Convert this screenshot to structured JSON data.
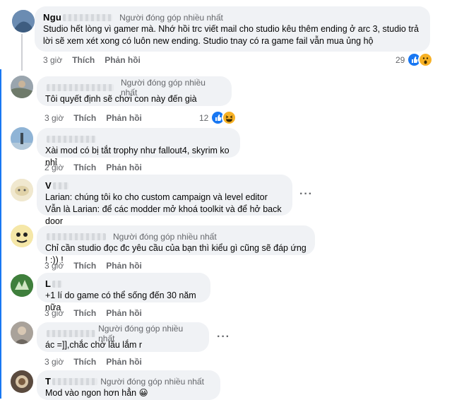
{
  "colors": {
    "bubble": "#f0f2f5",
    "meta": "#65676b",
    "like": "#1877f2",
    "emoji": "#f7b125"
  },
  "badge_label": "Người đóng góp nhiều nhất",
  "comments": [
    {
      "author": "Ngu",
      "badge": "Người đóng góp nhiều nhất",
      "text": "Studio hết lòng vì gamer mà. Nhớ hồi trc viết mail cho studio kêu thêm ending ở arc 3, studio trả lời sẽ xem xét xong có luôn new ending. Studio tnay có ra game fail vẫn mua ủng hộ",
      "time": "3 giờ",
      "like": "Thích",
      "reply": "Phản hồi",
      "reaction_count": "29",
      "reactions": [
        "like-icon",
        "wow-icon"
      ]
    },
    {
      "author": "",
      "badge": "Người đóng góp nhiều nhất",
      "text": "Tôi quyết định sẽ chơi con này đến già",
      "time": "3 giờ",
      "like": "Thích",
      "reply": "Phản hồi",
      "reaction_count": "12",
      "reactions": [
        "like-icon",
        "haha-icon"
      ]
    },
    {
      "author": "",
      "text": "Xài mod có bị tắt trophy như fallout4, skyrim ko nhỉ",
      "time": "2 giờ",
      "like": "Thích",
      "reply": "Phản hồi"
    },
    {
      "author": "V",
      "text": "Larian: chúng tôi ko cho custom campaign và level editor\nVẫn là Larian: để các modder mở khoá toolkit và để hở back door",
      "time": "",
      "like": "",
      "reply": ""
    },
    {
      "author": "",
      "badge": "Người đóng góp nhiều nhất",
      "text": "Chỉ cần studio đọc đc yêu cầu của bạn thì kiểu gì cũng sẽ đáp ứng ! :)) !",
      "time": "3 giờ",
      "like": "Thích",
      "reply": "Phản hồi"
    },
    {
      "author": "L",
      "text": "+1 lí do game có thể sống đến 30 năm nữa",
      "time": "3 giờ",
      "like": "Thích",
      "reply": "Phản hồi"
    },
    {
      "author": "",
      "badge": "Người đóng góp nhiều nhất",
      "text": "ác =]],chắc chờ lâu lắm r",
      "time": "3 giờ",
      "like": "Thích",
      "reply": "Phản hồi"
    },
    {
      "author": "T",
      "badge": "Người đóng góp nhiều nhất",
      "text": "Mod vào ngon hơn hẳn 😀",
      "time": "3 giờ",
      "like": "Thích",
      "reply": "Phản hồi"
    }
  ]
}
